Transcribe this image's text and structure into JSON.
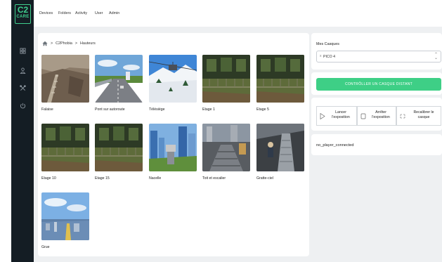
{
  "sidebar": {
    "logo_top": "C2",
    "logo_bottom": "CARE",
    "items": [
      {
        "name": "dashboard-icon"
      },
      {
        "name": "user-icon"
      },
      {
        "name": "tools-icon"
      },
      {
        "name": "power-icon"
      }
    ]
  },
  "topnav": {
    "items": [
      "Devices",
      "Folders",
      "Activity",
      "User",
      "Admin"
    ]
  },
  "breadcrumb": {
    "home_icon": "home-icon",
    "items": [
      "C2Phobia",
      "Hauteurs"
    ],
    "separator": ">"
  },
  "scenes": [
    {
      "label": "Falaise",
      "scene": "cliff"
    },
    {
      "label": "Pont sur autoroute",
      "scene": "bridge"
    },
    {
      "label": "Télésiège",
      "scene": "chairlift"
    },
    {
      "label": "Etage 1",
      "scene": "floor"
    },
    {
      "label": "Etage 5",
      "scene": "floor"
    },
    {
      "label": "Etage 10",
      "scene": "floor"
    },
    {
      "label": "Etage 15",
      "scene": "floor"
    },
    {
      "label": "Nacelle",
      "scene": "city"
    },
    {
      "label": "Toit et escalier",
      "scene": "roof"
    },
    {
      "label": "Gratte-ciel",
      "scene": "skyscraper"
    },
    {
      "label": "Grue",
      "scene": "crane"
    }
  ],
  "right_panel": {
    "mes_casques_label": "Mes Casques",
    "selected_headset": "PICO 4",
    "clear_icon": "x",
    "remote_button": "CONTRÔLLER UN CASQUE DISTANT",
    "actions": [
      {
        "line1": "Lancer",
        "line2": "l'exposition",
        "icon": "play-icon"
      },
      {
        "line1": "Arrêter",
        "line2": "l'exposition",
        "icon": "stop-icon"
      },
      {
        "line1": "Recalibrer le",
        "line2": "casque",
        "icon": "recalibrate-icon"
      }
    ],
    "status_text": "no_player_connected"
  },
  "colors": {
    "sidebar": "#141d24",
    "accent": "#3ecf86",
    "background": "#eef0f2"
  }
}
